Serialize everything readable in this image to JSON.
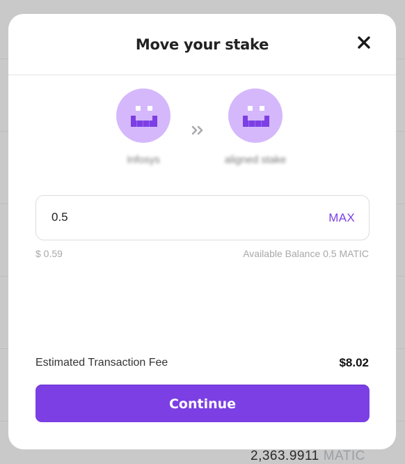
{
  "background": {
    "bottom_amount": "2,363.9911",
    "bottom_unit": "MATIC"
  },
  "modal": {
    "title": "Move your stake",
    "close_icon": "close-icon",
    "from_validator": {
      "name": "Infosys",
      "avatar_icon": "smiley-avatar-icon"
    },
    "transfer_icon": "double-chevron-right-icon",
    "to_validator": {
      "name": "aligned stake",
      "avatar_icon": "smiley-avatar-icon"
    },
    "amount": {
      "value": "0.5",
      "max_label": "MAX",
      "fiat_value": "$ 0.59",
      "balance_text": "Available Balance 0.5 MATIC"
    },
    "fee": {
      "label": "Estimated Transaction Fee",
      "value": "$8.02"
    },
    "continue_label": "Continue"
  },
  "colors": {
    "accent": "#7b3fe4",
    "avatar_bg": "#d5b8fb",
    "avatar_face": "#7b3fe4",
    "backdrop": "#c9c9c9"
  }
}
